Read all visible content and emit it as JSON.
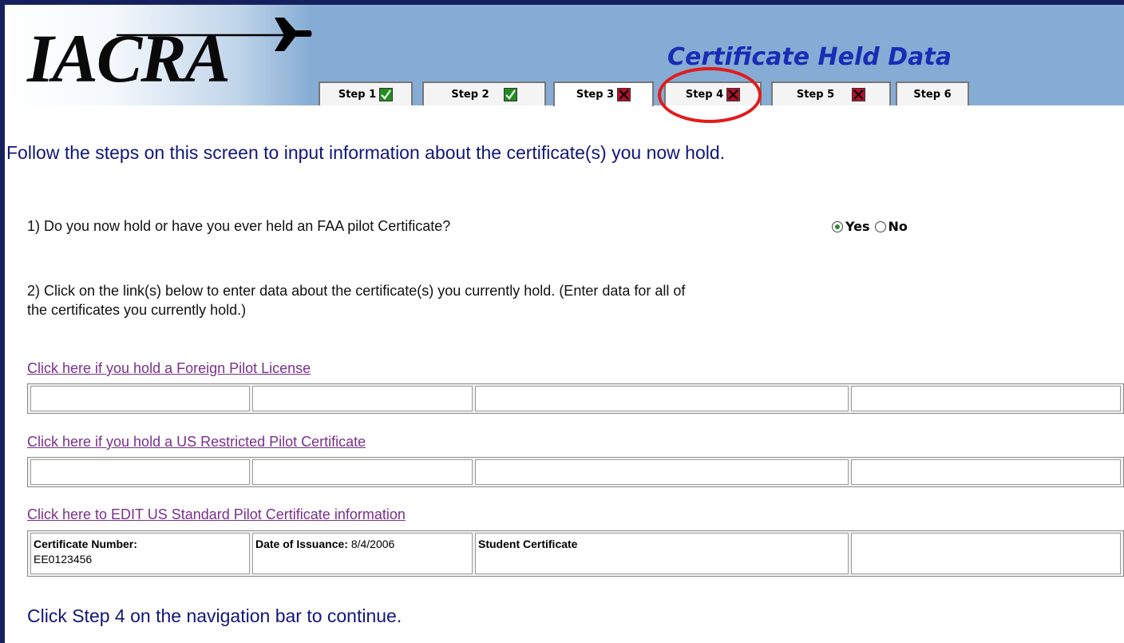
{
  "app": {
    "logo_text": "IACRA",
    "page_title": "Certificate Held Data"
  },
  "tabs": [
    {
      "label": "Step 1",
      "status": "complete"
    },
    {
      "label": "Step 2",
      "status": "complete"
    },
    {
      "label": "Step 3",
      "status": "incomplete"
    },
    {
      "label": "Step 4",
      "status": "incomplete"
    },
    {
      "label": "Step 5",
      "status": "incomplete"
    },
    {
      "label": "Step 6",
      "status": "none"
    }
  ],
  "active_tab": "Step 3",
  "highlighted_tab": "Step 4",
  "instructions": "Follow the steps on this screen to input information about the certificate(s) you now hold.",
  "question1": {
    "text": "1) Do you now hold or have you ever held an FAA pilot Certificate?",
    "options": [
      "Yes",
      "No"
    ],
    "selected": "Yes"
  },
  "question2": {
    "line1": "2) Click on the link(s) below to enter data about the certificate(s) you currently hold.   (Enter data for all of",
    "line2": "the certificates you currently hold.)"
  },
  "sections": {
    "foreign": {
      "link": "Click here if you hold a Foreign Pilot License"
    },
    "restricted": {
      "link": "Click here if you hold a US Restricted Pilot Certificate"
    },
    "standard": {
      "link": "Click here to EDIT US Standard Pilot Certificate information",
      "cert_number_label": "Certificate Number:",
      "cert_number_value": "EE0123456",
      "issuance_label": "Date of Issuance:",
      "issuance_value": "8/4/2006",
      "certificate_type": "Student Certificate"
    }
  },
  "continue_text": "Click Step 4 on the navigation bar to continue.",
  "colors": {
    "border": "#17205e",
    "header_bg": "#85acd4",
    "title": "#1a2cb5",
    "link": "#7a2f8c",
    "instruction": "#12167a",
    "highlight": "#e31b1b",
    "complete": "#1e8f1e",
    "incomplete": "#b8102a"
  }
}
